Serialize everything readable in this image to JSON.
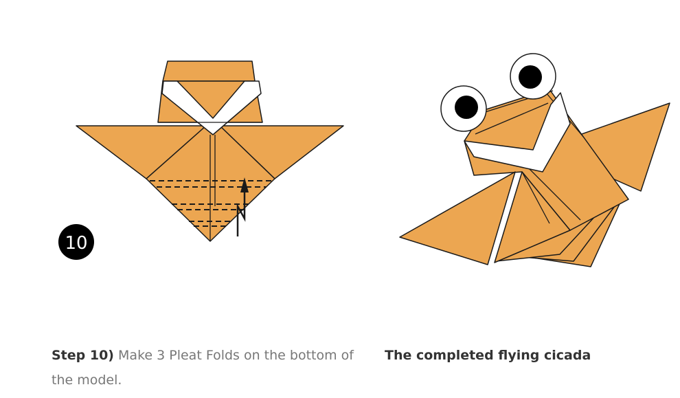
{
  "step_figure": {
    "badge_number": "10",
    "caption_bold": "Step 10)",
    "caption_text": " Make 3 Pleat Folds on the bottom of the model."
  },
  "completed_figure": {
    "caption_bold": "The completed flying cicada"
  },
  "colors": {
    "paper": "#eca651",
    "outline": "#1a1a1a",
    "white_stripe": "#ffffff",
    "badge": "#000000"
  },
  "icons": [
    "up-arrow-icon",
    "number-badge-icon",
    "eye-icon"
  ]
}
